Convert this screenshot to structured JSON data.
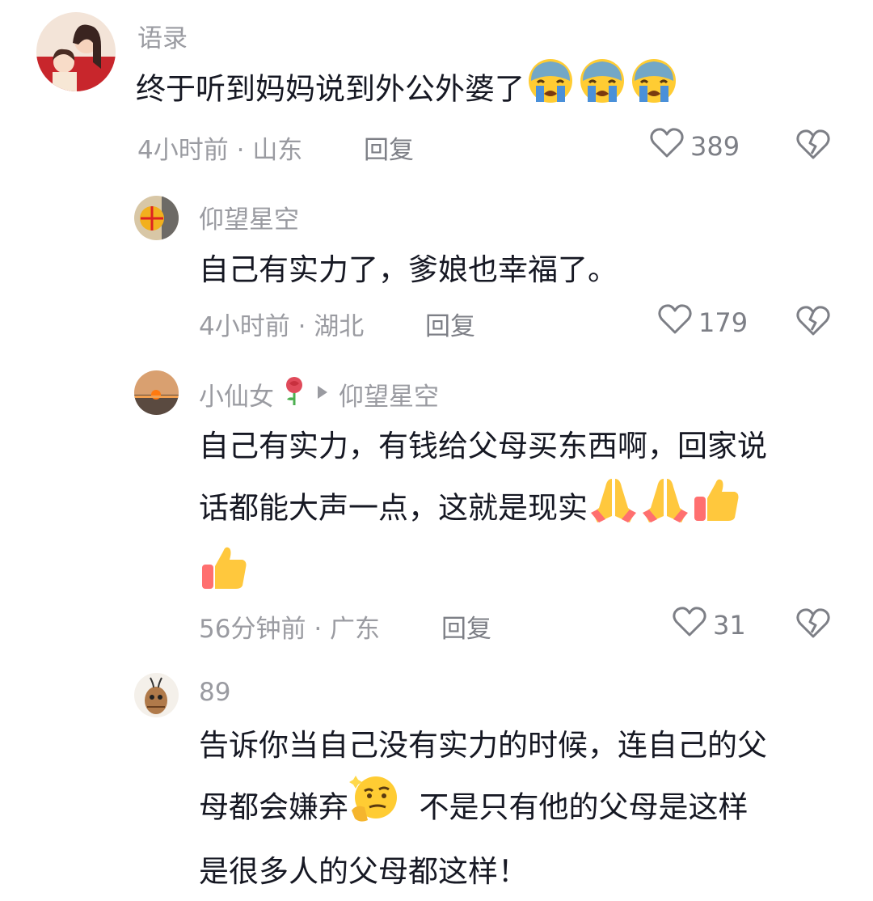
{
  "comments": [
    {
      "username": "语录",
      "text": "终于听到妈妈说到外公外婆了",
      "time": "4小时前",
      "location": "山东",
      "reply_label": "回复",
      "likes": "389",
      "emoji": [
        "loudly-crying-face",
        "loudly-crying-face",
        "loudly-crying-face"
      ]
    },
    {
      "username": "仰望星空",
      "text": "自己有实力了，爹娘也幸福了。",
      "time": "4小时前",
      "location": "湖北",
      "reply_label": "回复",
      "likes": "179"
    },
    {
      "username": "小仙女",
      "name_emoji": "rose",
      "reply_to": "仰望星空",
      "text_line1": "自己有实力，有钱给父母买东西啊，回家说",
      "text_line2": "话都能大声一点，这就是现实",
      "emoji": [
        "folded-hands",
        "folded-hands",
        "thumbs-up",
        "thumbs-up"
      ],
      "time": "56分钟前",
      "location": "广东",
      "reply_label": "回复",
      "likes": "31"
    },
    {
      "username": "89",
      "text_line1": "告诉你当自己没有实力的时候，连自己的父",
      "text_line2a": "母都会嫌弃",
      "text_line2b": "  不是只有他的父母是这样",
      "text_line3": "是很多人的父母都这样！",
      "emoji": [
        "thinking-face"
      ]
    }
  ],
  "separator": "·",
  "colors": {
    "text": "#161823",
    "meta": "#9a9ba1",
    "background": "#ffffff"
  },
  "icons": [
    "heart-outline-icon",
    "broken-heart-icon",
    "reply-arrow-icon"
  ]
}
